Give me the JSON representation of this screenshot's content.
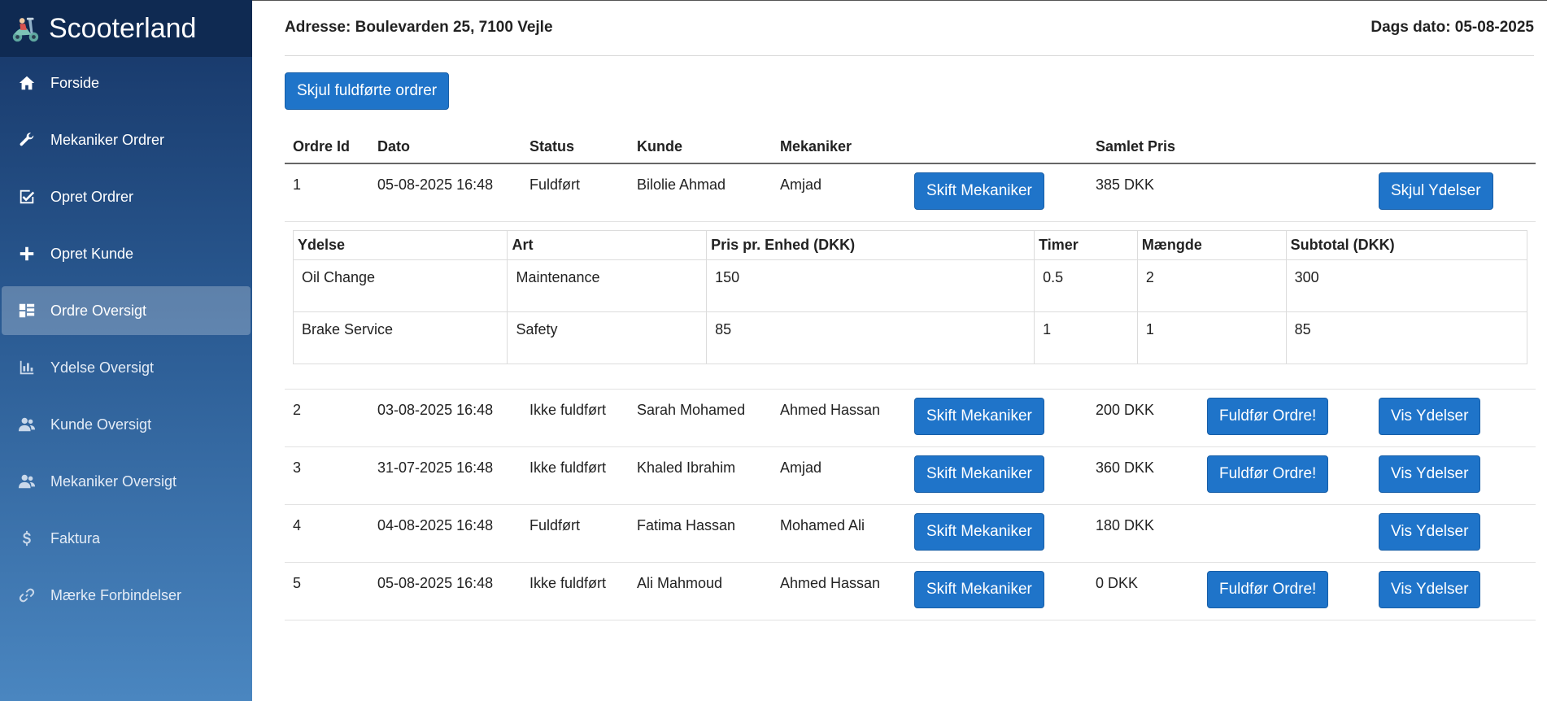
{
  "brand": {
    "title": "Scooterland",
    "logo_icon": "scooter-icon"
  },
  "nav": [
    {
      "label": "Forside",
      "icon": "home-icon"
    },
    {
      "label": "Mekaniker Ordrer",
      "icon": "wrench-icon"
    },
    {
      "label": "Opret Ordrer",
      "icon": "checkbox-icon"
    },
    {
      "label": "Opret Kunde",
      "icon": "plus-icon"
    },
    {
      "label": "Ordre Oversigt",
      "icon": "list-icon",
      "active": true
    },
    {
      "label": "Ydelse Oversigt",
      "icon": "bar-chart-icon"
    },
    {
      "label": "Kunde Oversigt",
      "icon": "users-icon"
    },
    {
      "label": "Mekaniker Oversigt",
      "icon": "users-icon"
    },
    {
      "label": "Faktura",
      "icon": "dollar-icon"
    },
    {
      "label": "Mærke Forbindelser",
      "icon": "link-icon"
    }
  ],
  "header": {
    "address": "Adresse: Boulevarden 25, 7100 Vejle",
    "date": "Dags dato: 05-08-2025"
  },
  "actions": {
    "hide_completed": "Skjul fuldførte ordrer"
  },
  "orders_table": {
    "columns": [
      "Ordre Id",
      "Dato",
      "Status",
      "Kunde",
      "Mekaniker",
      "",
      "Samlet Pris",
      "",
      ""
    ],
    "change_mechanic_label": "Skift Mekaniker",
    "complete_label": "Fuldfør Ordre!",
    "show_services_label": "Vis Ydelser",
    "hide_services_label": "Skjul Ydelser",
    "rows": [
      {
        "id": "1",
        "date": "05-08-2025 16:48",
        "status": "Fuldført",
        "customer": "Bilolie Ahmad",
        "mechanic": "Amjad",
        "total": "385 DKK",
        "can_complete": false,
        "expanded": true
      },
      {
        "id": "2",
        "date": "03-08-2025 16:48",
        "status": "Ikke fuldført",
        "customer": "Sarah Mohamed",
        "mechanic": "Ahmed Hassan",
        "total": "200 DKK",
        "can_complete": true,
        "expanded": false
      },
      {
        "id": "3",
        "date": "31-07-2025 16:48",
        "status": "Ikke fuldført",
        "customer": "Khaled Ibrahim",
        "mechanic": "Amjad",
        "total": "360 DKK",
        "can_complete": true,
        "expanded": false
      },
      {
        "id": "4",
        "date": "04-08-2025 16:48",
        "status": "Fuldført",
        "customer": "Fatima Hassan",
        "mechanic": "Mohamed Ali",
        "total": "180 DKK",
        "can_complete": false,
        "expanded": false
      },
      {
        "id": "5",
        "date": "05-08-2025 16:48",
        "status": "Ikke fuldført",
        "customer": "Ali Mahmoud",
        "mechanic": "Ahmed Hassan",
        "total": "0 DKK",
        "can_complete": true,
        "expanded": false
      }
    ]
  },
  "services_table": {
    "columns": [
      "Ydelse",
      "Art",
      "Pris pr. Enhed (DKK)",
      "Timer",
      "Mængde",
      "Subtotal (DKK)"
    ],
    "rows": [
      [
        "Oil Change",
        "Maintenance",
        "150",
        "0.5",
        "2",
        "300"
      ],
      [
        "Brake Service",
        "Safety",
        "85",
        "1",
        "1",
        "85"
      ]
    ]
  }
}
